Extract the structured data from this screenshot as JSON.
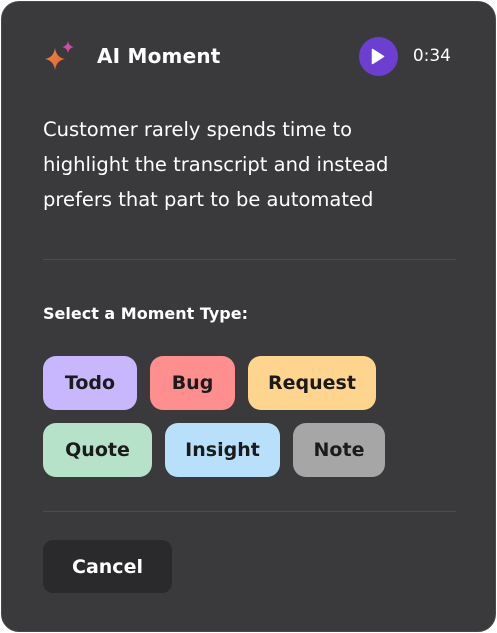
{
  "header": {
    "icon": "sparkle-icon",
    "title": "AI Moment",
    "play_icon": "play-icon",
    "duration": "0:34"
  },
  "description": "Customer rarely spends time to highlight the transcript and instead prefers that part to be automated",
  "moment_types": {
    "label": "Select a Moment Type:",
    "options": [
      {
        "label": "Todo",
        "color": "#c8b6ff"
      },
      {
        "label": "Bug",
        "color": "#ff8f8f"
      },
      {
        "label": "Request",
        "color": "#ffd48f"
      },
      {
        "label": "Quote",
        "color": "#b5e2c9"
      },
      {
        "label": "Insight",
        "color": "#b8e0fb"
      },
      {
        "label": "Note",
        "color": "#a6a6a6"
      }
    ]
  },
  "actions": {
    "cancel_label": "Cancel"
  },
  "colors": {
    "card_background": "#3a3a3d",
    "play_button": "#6d3fd0",
    "cancel_background": "#2a2a2c"
  }
}
